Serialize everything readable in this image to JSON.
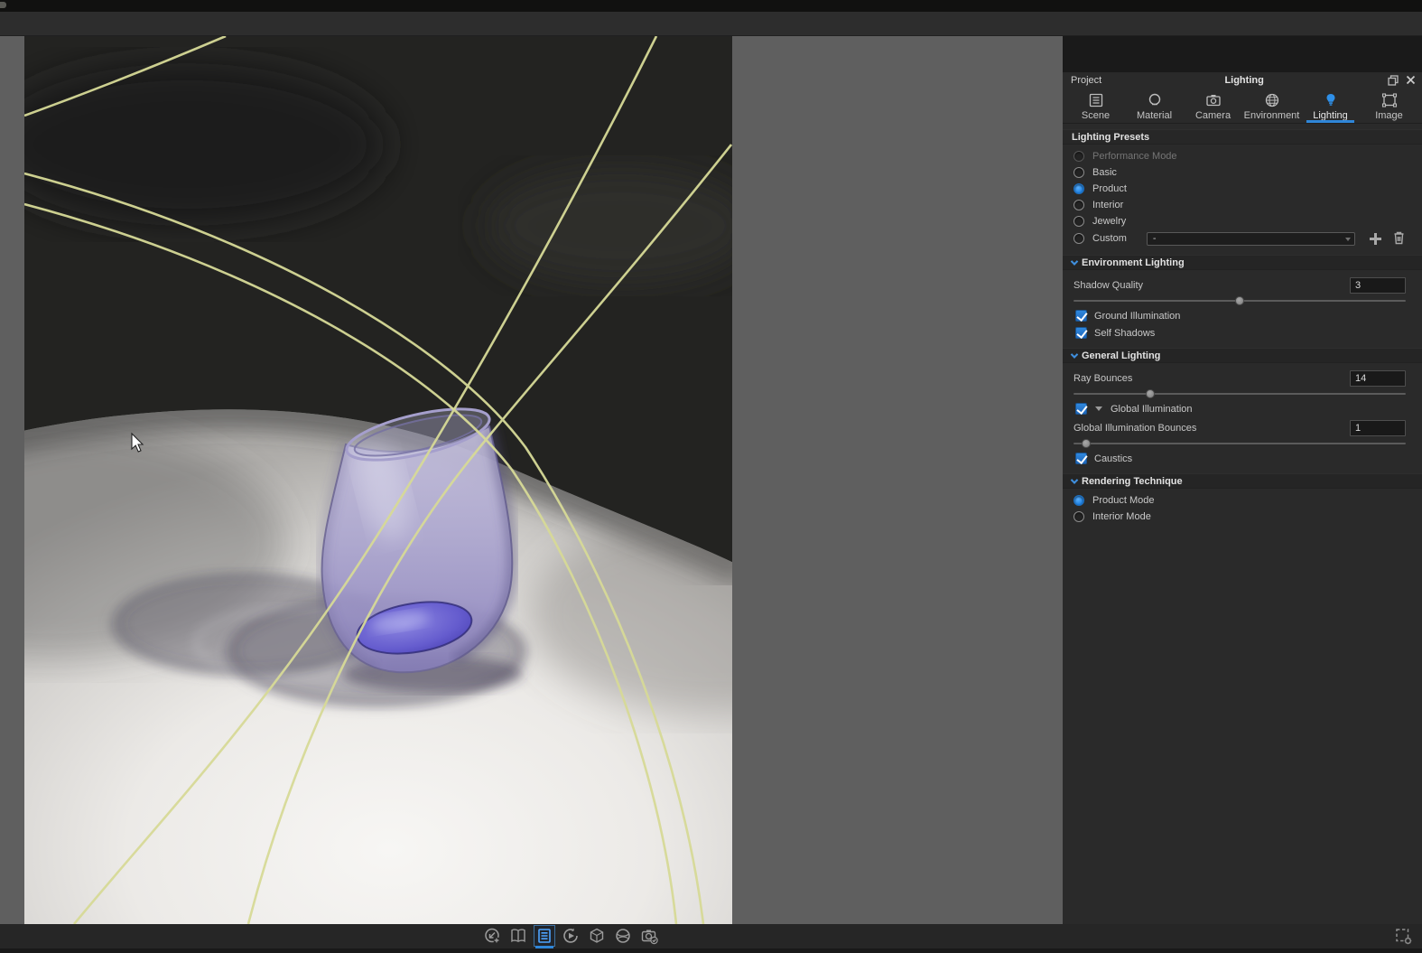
{
  "panel": {
    "header": {
      "project_label": "Project",
      "title": "Lighting"
    },
    "tabs": [
      {
        "label": "Scene"
      },
      {
        "label": "Material"
      },
      {
        "label": "Camera"
      },
      {
        "label": "Environment"
      },
      {
        "label": "Lighting",
        "active": true
      },
      {
        "label": "Image"
      }
    ],
    "lighting_presets": {
      "title": "Lighting Presets",
      "options": [
        {
          "label": "Performance Mode",
          "state": "disabled",
          "selected": false
        },
        {
          "label": "Basic",
          "selected": false
        },
        {
          "label": "Product",
          "selected": true
        },
        {
          "label": "Interior",
          "selected": false
        },
        {
          "label": "Jewelry",
          "selected": false
        },
        {
          "label": "Custom",
          "selected": false
        }
      ],
      "custom_value": "-"
    },
    "environment_lighting": {
      "title": "Environment Lighting",
      "shadow_quality_label": "Shadow Quality",
      "shadow_quality_value": "3",
      "shadow_quality_slider_percent": 50,
      "ground_illumination": {
        "label": "Ground Illumination",
        "checked": true
      },
      "self_shadows": {
        "label": "Self Shadows",
        "checked": true
      }
    },
    "general_lighting": {
      "title": "General Lighting",
      "ray_bounces_label": "Ray Bounces",
      "ray_bounces_value": "14",
      "ray_bounces_slider_percent": 23,
      "global_illumination": {
        "label": "Global Illumination",
        "checked": true
      },
      "gi_bounces_label": "Global Illumination Bounces",
      "gi_bounces_value": "1",
      "gi_bounces_slider_percent": 3,
      "caustics": {
        "label": "Caustics",
        "checked": true
      }
    },
    "rendering_technique": {
      "title": "Rendering Technique",
      "options": [
        {
          "label": "Product Mode",
          "selected": true
        },
        {
          "label": "Interior Mode",
          "selected": false
        }
      ]
    }
  },
  "dock": {
    "icons": [
      "import",
      "library",
      "project",
      "animation",
      "keyshotxr",
      "material-studio",
      "render"
    ],
    "active_icon": "project",
    "corner_icon": "region-settings"
  },
  "viewport": {
    "content": "tilted lavender stemless glass on white ground, dark backdrop, yellow spline overlay curves, arrow cursor"
  },
  "colors": {
    "accent_blue": "#2f86d8",
    "selection_blue": "#1d7fe0",
    "panel_bg": "#2a2a2a",
    "workspace_bg": "#5f5f5f",
    "dock_bg": "#262626",
    "spline_yellow": "#d7da97",
    "glass_lavender": "#aca6cf",
    "glass_pool_purple": "#5d54c6"
  }
}
